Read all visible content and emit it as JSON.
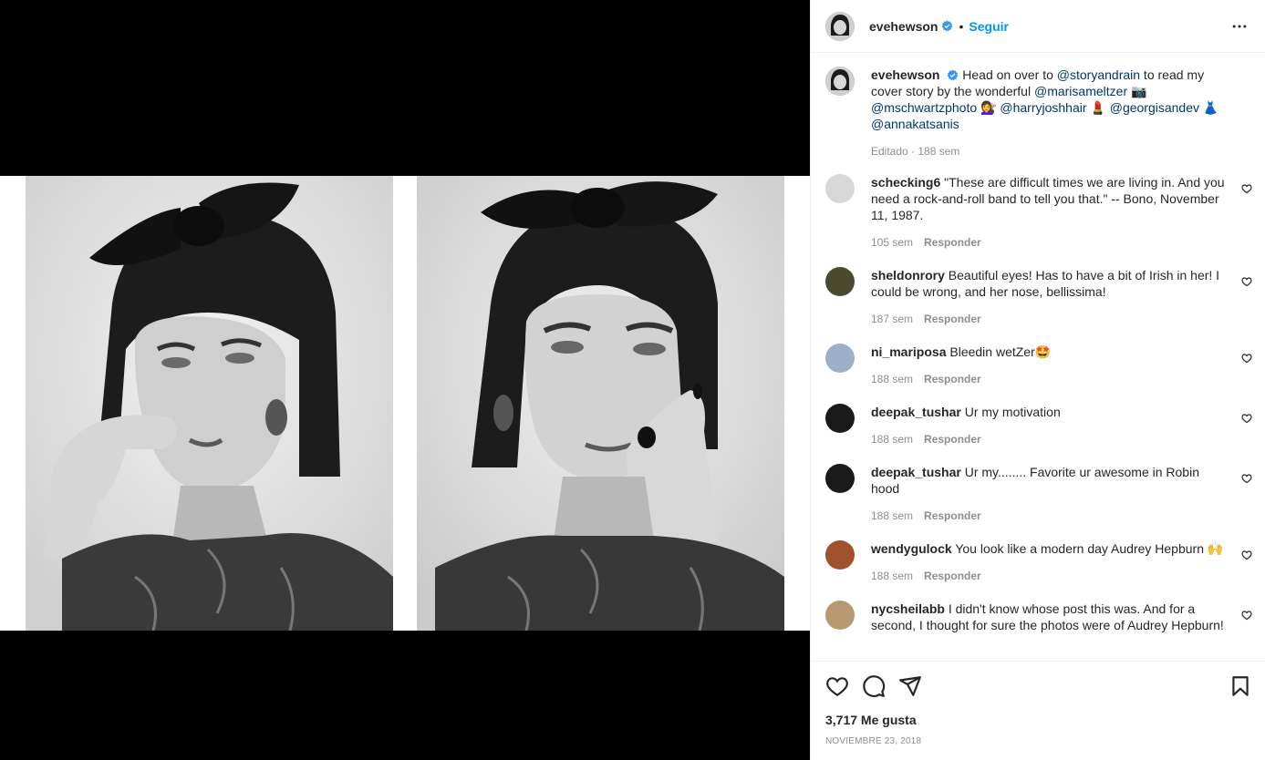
{
  "post": {
    "author": "evehewson",
    "follow_label": "Seguir",
    "separator": "•",
    "caption": {
      "username": "evehewson",
      "parts": [
        {
          "t": "Head on over to "
        },
        {
          "m": "@storyandrain"
        },
        {
          "t": " to read my cover story by the wonderful "
        },
        {
          "m": "@marisameltzer"
        },
        {
          "t": " 📷 "
        },
        {
          "m": "@mschwartzphoto"
        },
        {
          "t": " 💇‍♀️ "
        },
        {
          "m": "@harryjoshhair"
        },
        {
          "t": " 💄 "
        },
        {
          "m": "@georgisandev"
        },
        {
          "t": " 👗 "
        },
        {
          "m": "@annakatsanis"
        }
      ],
      "meta": "Editado · 188 sem"
    }
  },
  "comments": [
    {
      "username": "schecking6",
      "text": "\"These are difficult times we are living in. And you need a rock-and-roll band to tell you that.\" -- Bono, November 11, 1987.",
      "time": "105 sem",
      "reply": "Responder",
      "avatar_color": "#d8d8d8"
    },
    {
      "username": "sheldonrory",
      "text": "Beautiful eyes! Has to have a bit of Irish in her! I could be wrong, and her nose, bellissima!",
      "time": "187 sem",
      "reply": "Responder",
      "avatar_color": "#4a4a2e"
    },
    {
      "username": "ni_mariposa",
      "text": "Bleedin wetZer🤩",
      "time": "188 sem",
      "reply": "Responder",
      "avatar_color": "#9bb0c8"
    },
    {
      "username": "deepak_tushar",
      "text": "Ur my motivation",
      "time": "188 sem",
      "reply": "Responder",
      "avatar_color": "#1a1a1a"
    },
    {
      "username": "deepak_tushar",
      "text": "Ur my........ Favorite ur awesome in Robin hood",
      "time": "188 sem",
      "reply": "Responder",
      "avatar_color": "#1a1a1a"
    },
    {
      "username": "wendygulock",
      "text": "You look like a modern day Audrey Hepburn 🙌",
      "time": "188 sem",
      "reply": "Responder",
      "avatar_color": "#a0522d"
    },
    {
      "username": "nycsheilabb",
      "text": "I didn't know whose post this was. And for a second, I thought for sure the photos were of Audrey Hepburn!",
      "time": "",
      "reply": "",
      "avatar_color": "#b89a70"
    }
  ],
  "footer": {
    "likes": "3,717 Me gusta",
    "date": "NOVIEMBRE 23, 2018"
  },
  "colors": {
    "accent": "#0095f6",
    "verified": "#3897f0",
    "mention": "#00376b",
    "secondary_text": "#8e8e8e"
  },
  "icons": [
    "verified-badge-icon",
    "more-options-icon",
    "heart-icon",
    "comment-icon",
    "share-icon",
    "bookmark-icon"
  ]
}
